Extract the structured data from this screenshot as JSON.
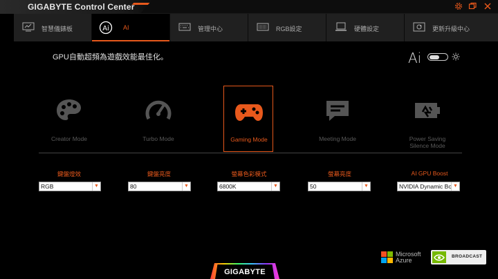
{
  "app": {
    "title": "GIGABYTE Control Center",
    "brand": "GIGABYTE"
  },
  "window_controls": [
    {
      "name": "settings-icon",
      "glyph": "⚙"
    },
    {
      "name": "restore-icon",
      "glyph": "▢"
    },
    {
      "name": "close-icon",
      "glyph": "✕"
    }
  ],
  "tabs": [
    {
      "label": "智慧儀錶板",
      "icon": "dashboard-icon",
      "active": false
    },
    {
      "label": "AI",
      "icon": "ai-icon",
      "active": true
    },
    {
      "label": "管理中心",
      "icon": "keyboard-icon",
      "active": false
    },
    {
      "label": "RGB設定",
      "icon": "rgb-keyboard-icon",
      "active": false
    },
    {
      "label": "硬體設定",
      "icon": "laptop-icon",
      "active": false
    },
    {
      "label": "更新升級中心",
      "icon": "update-icon",
      "active": false
    }
  ],
  "description": "GPU自動超頻為遊戲效能最佳化。",
  "ai_toggle": {
    "logo": "Ai"
  },
  "modes": [
    {
      "label": "Creator Mode",
      "icon": "palette-icon",
      "active": false
    },
    {
      "label": "Turbo Mode",
      "icon": "speedometer-icon",
      "active": false
    },
    {
      "label": "Gaming Mode",
      "icon": "gamepad-icon",
      "active": true
    },
    {
      "label": "Meeting Mode",
      "icon": "chat-icon",
      "active": false
    },
    {
      "label": "Power Saving\nSilence Mode",
      "icon": "battery-recycle-icon",
      "active": false
    }
  ],
  "settings": [
    {
      "label": "鍵盤燈效",
      "value": "RGB"
    },
    {
      "label": "鍵盤亮度",
      "value": "80"
    },
    {
      "label": "螢幕色彩模式",
      "value": "6800K"
    },
    {
      "label": "螢幕亮度",
      "value": "50"
    },
    {
      "label": "AI GPU Boost",
      "value": "NVIDIA Dynamic Boost"
    }
  ],
  "partners": {
    "microsoft_line1": "Microsoft",
    "microsoft_line2": "Azure",
    "nvidia": "BROADCAST"
  },
  "colors": {
    "accent": "#e8591c",
    "background": "#000000",
    "tabbar": "#202020",
    "nvidia_green": "#76b900"
  }
}
